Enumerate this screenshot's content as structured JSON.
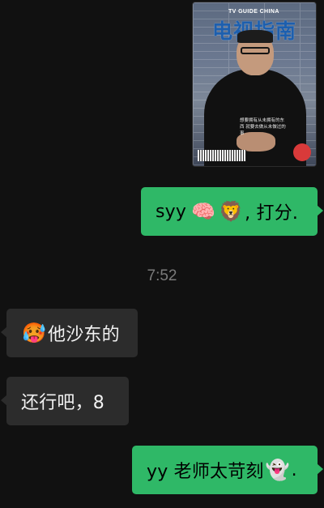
{
  "image_message": {
    "tag": "TV GUIDE CHINA",
    "title": "电视指南",
    "quote": "想要拥有从未拥有的东西 就要去做从未做过的事"
  },
  "messages": [
    {
      "direction": "outgoing",
      "parts": [
        {
          "text": "syy"
        },
        {
          "icon": "brain-icon",
          "glyph": "🧠"
        },
        {
          "icon": "lion-icon",
          "glyph": "🦁"
        },
        {
          "text": ", 打分."
        }
      ]
    },
    {
      "direction": "incoming",
      "parts": [
        {
          "icon": "cold-face-icon",
          "glyph": "🥵"
        },
        {
          "text": "他沙东的"
        }
      ]
    },
    {
      "direction": "incoming",
      "parts": [
        {
          "text": "还行吧，8"
        }
      ]
    },
    {
      "direction": "outgoing",
      "parts": [
        {
          "text": "yy 老师太苛刻"
        },
        {
          "icon": "ghost-icon",
          "glyph": "👻"
        },
        {
          "text": "."
        }
      ]
    }
  ],
  "timestamp": "7:52",
  "colors": {
    "background": "#111111",
    "outgoing_bubble": "#2fb867",
    "incoming_bubble": "#2c2c2c",
    "timestamp": "#7b7b7b"
  }
}
